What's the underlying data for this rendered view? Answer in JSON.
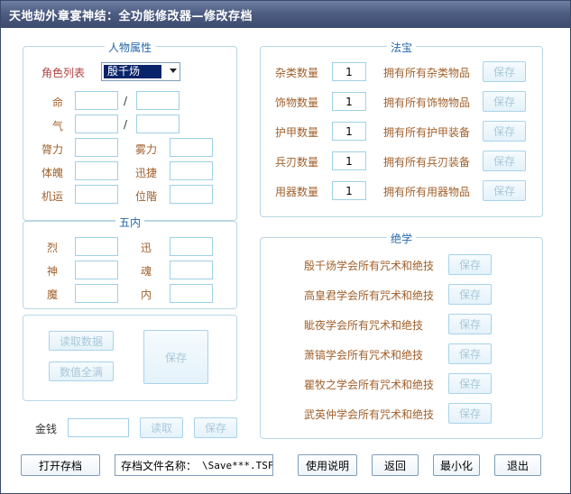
{
  "window": {
    "title": "天地劫外章宴神结：全功能修改器—修改存档"
  },
  "attributes": {
    "title": "人物属性",
    "role_list_label": "角色列表",
    "role_selected": "殷千炀",
    "hp_label": "命",
    "mp_label": "气",
    "slash": "/",
    "stats": {
      "strength": "膂力",
      "agility": "雾力",
      "physique": "体魄",
      "speed": "迅捷",
      "luck": "机运",
      "rank": "位階"
    }
  },
  "wunei": {
    "title": "五内",
    "lie": "烈",
    "xun": "迅",
    "shen": "神",
    "hun": "魂",
    "mo": "魔",
    "nei": "内"
  },
  "data_buttons": {
    "read": "读取数据",
    "fill": "数值全满",
    "save": "保存"
  },
  "money": {
    "label": "金钱",
    "read": "读取",
    "save": "保存"
  },
  "treasure": {
    "title": "法宝",
    "rows": [
      {
        "label": "杂类数量",
        "value": "1",
        "action": "拥有所有杂类物品",
        "save": "保存"
      },
      {
        "label": "饰物数量",
        "value": "1",
        "action": "拥有所有饰物物品",
        "save": "保存"
      },
      {
        "label": "护甲数量",
        "value": "1",
        "action": "拥有所有护甲装备",
        "save": "保存"
      },
      {
        "label": "兵刃数量",
        "value": "1",
        "action": "拥有所有兵刃装备",
        "save": "保存"
      },
      {
        "label": "用器数量",
        "value": "1",
        "action": "拥有所有用器物品",
        "save": "保存"
      }
    ]
  },
  "skills": {
    "title": "绝学",
    "rows": [
      {
        "label": "殷千炀学会所有咒术和绝技",
        "save": "保存"
      },
      {
        "label": "高皇君学会所有咒术和绝技",
        "save": "保存"
      },
      {
        "label": "眦夜学会所有咒术和绝技",
        "save": "保存"
      },
      {
        "label": "萧镐学会所有咒术和绝技",
        "save": "保存"
      },
      {
        "label": "瞿牧之学会所有咒术和绝技",
        "save": "保存"
      },
      {
        "label": "武英仲学会所有咒术和绝技",
        "save": "保存"
      }
    ]
  },
  "bottom": {
    "open": "打开存档",
    "file_label": "存档文件名称：",
    "file_value": "\\Save***.TSF",
    "help": "使用说明",
    "back": "返回",
    "minimize": "最小化",
    "exit": "退出"
  }
}
